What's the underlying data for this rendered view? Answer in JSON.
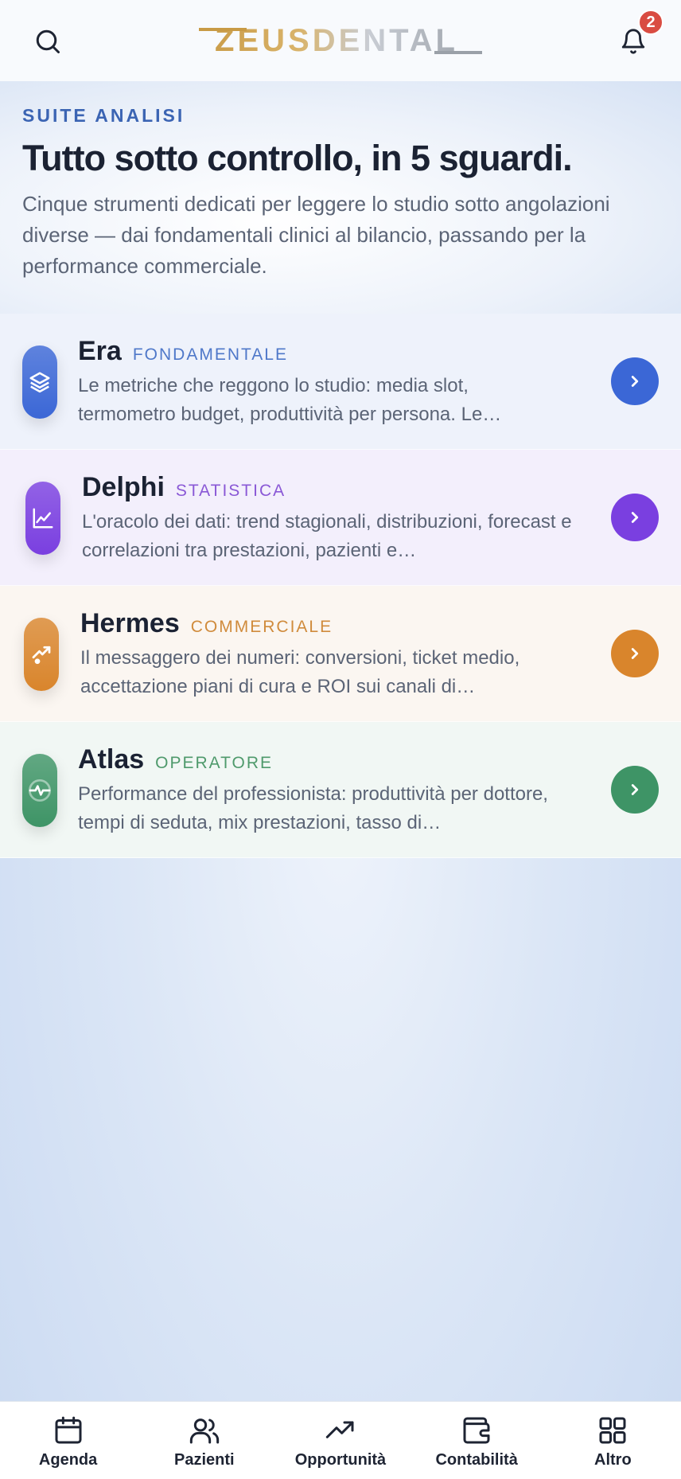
{
  "header": {
    "logo_text": "ZEUSDENTAL",
    "notification_count": "2",
    "search_icon": "search-icon",
    "bell_icon": "bell-icon"
  },
  "hero": {
    "eyebrow": "SUITE ANALISI",
    "title": "Tutto sotto controllo, in 5 sguardi.",
    "subtitle": "Cinque strumenti dedicati per leggere lo studio sotto angolazioni diverse — dai fondamentali clinici al bilancio, passando per la performance commerciale."
  },
  "cards": [
    {
      "title": "Era",
      "tag": "FONDAMENTALE",
      "description": "Le metriche che reggono lo studio: media slot, termometro budget, produttività per persona. Le…",
      "icon": "layers-icon",
      "accent": "#3b67d6",
      "tag_color": "#4f78c9",
      "bg": "#eef2fb"
    },
    {
      "title": "Delphi",
      "tag": "STATISTICA",
      "description": "L'oracolo dei dati: trend stagionali, distribuzioni, forecast e correlazioni tra prestazioni, pazienti e…",
      "icon": "line-chart-icon",
      "accent": "#7a3fe0",
      "tag_color": "#8a58d6",
      "bg": "#f3effc"
    },
    {
      "title": "Hermes",
      "tag": "COMMERCIALE",
      "description": "Il messaggero dei numeri: conversioni, ticket medio, accettazione piani di cura e ROI sui canali di…",
      "icon": "trending-up-icon",
      "accent": "#d9852c",
      "tag_color": "#d08b3c",
      "bg": "#fbf6f1"
    },
    {
      "title": "Atlas",
      "tag": "OPERATORE",
      "description": "Performance del professionista: produttività per dottore, tempi di seduta, mix prestazioni, tasso di…",
      "icon": "pulse-icon",
      "accent": "#3e9466",
      "tag_color": "#4f9a6c",
      "bg": "#f1f7f4"
    }
  ],
  "nav": [
    {
      "label": "Agenda",
      "icon": "calendar-icon"
    },
    {
      "label": "Pazienti",
      "icon": "users-icon"
    },
    {
      "label": "Opportunità",
      "icon": "trending-up-icon"
    },
    {
      "label": "Contabilità",
      "icon": "wallet-icon"
    },
    {
      "label": "Altro",
      "icon": "grid-icon"
    }
  ]
}
